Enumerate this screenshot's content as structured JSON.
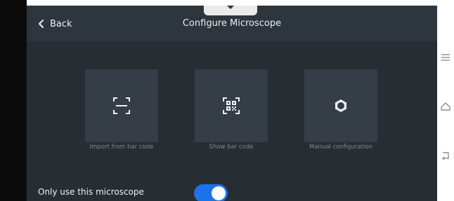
{
  "header": {
    "back_label": "Back",
    "title": "Configure Microscope"
  },
  "tiles": [
    {
      "label": "Import from bar code",
      "icon": "scan-frame-icon"
    },
    {
      "label": "Show bar code",
      "icon": "qr-code-icon"
    },
    {
      "label": "Manual configuration",
      "icon": "gear-icon"
    }
  ],
  "option": {
    "label": "Only use this microscope",
    "toggle_on": true
  },
  "side_nav": [
    "menu-icon",
    "home-icon",
    "return-icon"
  ],
  "colors": {
    "accent": "#1a73e8",
    "screen_bg": "#262d33",
    "header_bg": "#2d363d",
    "tile_bg": "#353e46"
  }
}
